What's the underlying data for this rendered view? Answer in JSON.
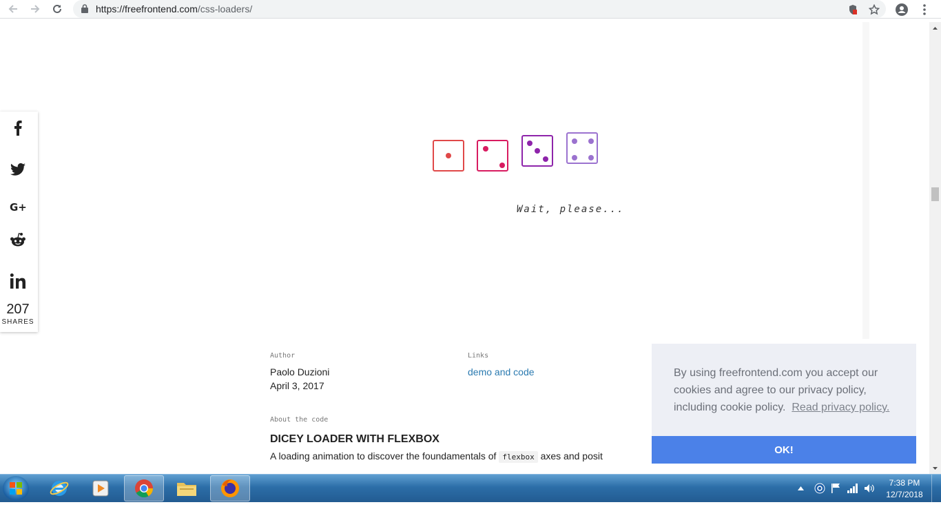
{
  "browser": {
    "url_host": "https://freefrontend.com",
    "url_path": "/css-loaders/"
  },
  "share": {
    "count": "207",
    "label": "SHARES",
    "networks": [
      "facebook",
      "twitter",
      "google-plus",
      "reddit",
      "linkedin"
    ]
  },
  "loader": {
    "wait_text": "Wait, please...",
    "dice_colors": [
      "#e04848",
      "#d81b60",
      "#8e24aa",
      "#9b72cf"
    ]
  },
  "meta": {
    "author_label": "Author",
    "author_name": "Paolo Duzioni",
    "date": "April 3, 2017",
    "links_label": "Links",
    "links_value": "demo and code",
    "about_label": "About the code",
    "title": "DICEY LOADER WITH FLEXBOX",
    "desc_before": "A loading animation to discover the foundamentals of",
    "desc_code": "flexbox",
    "desc_after": "axes and posit"
  },
  "cookie": {
    "text": "By using freefrontend.com you accept our cookies and agree to our privacy policy, including cookie policy.",
    "link": "Read privacy policy.",
    "ok": "OK!",
    "accent": "#4b81e8"
  },
  "taskbar": {
    "time": "7:38 PM",
    "date": "12/7/2018",
    "apps": [
      "internet-explorer",
      "media-player",
      "chrome",
      "file-explorer",
      "firefox"
    ]
  }
}
